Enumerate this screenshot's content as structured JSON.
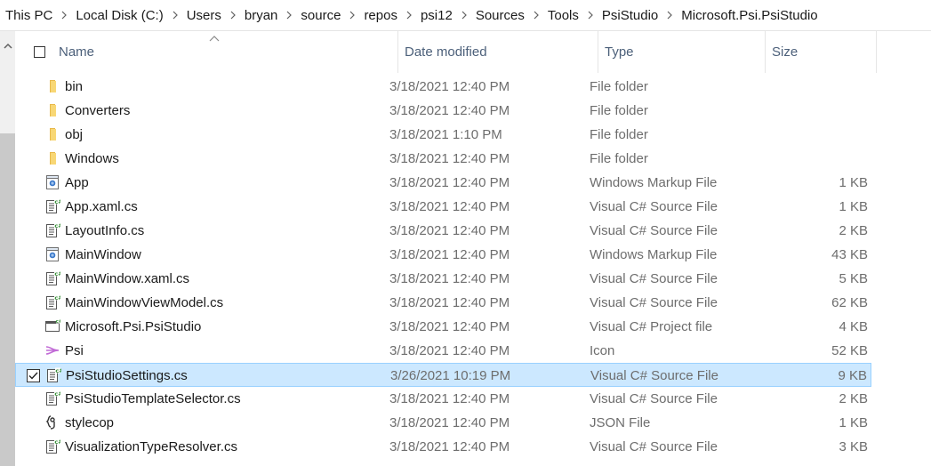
{
  "breadcrumb": [
    "This PC",
    "Local Disk (C:)",
    "Users",
    "bryan",
    "source",
    "repos",
    "psi12",
    "Sources",
    "Tools",
    "PsiStudio",
    "Microsoft.Psi.PsiStudio"
  ],
  "columns": {
    "name": "Name",
    "date": "Date modified",
    "type": "Type",
    "size": "Size"
  },
  "files": [
    {
      "name": "bin",
      "date": "3/18/2021 12:40 PM",
      "type": "File folder",
      "size": "",
      "icon": "folder-icon"
    },
    {
      "name": "Converters",
      "date": "3/18/2021 12:40 PM",
      "type": "File folder",
      "size": "",
      "icon": "folder-icon"
    },
    {
      "name": "obj",
      "date": "3/18/2021 1:10 PM",
      "type": "File folder",
      "size": "",
      "icon": "folder-icon"
    },
    {
      "name": "Windows",
      "date": "3/18/2021 12:40 PM",
      "type": "File folder",
      "size": "",
      "icon": "folder-icon"
    },
    {
      "name": "App",
      "date": "3/18/2021 12:40 PM",
      "type": "Windows Markup File",
      "size": "1 KB",
      "icon": "xaml-file-icon"
    },
    {
      "name": "App.xaml.cs",
      "date": "3/18/2021 12:40 PM",
      "type": "Visual C# Source File",
      "size": "1 KB",
      "icon": "csharp-file-icon"
    },
    {
      "name": "LayoutInfo.cs",
      "date": "3/18/2021 12:40 PM",
      "type": "Visual C# Source File",
      "size": "2 KB",
      "icon": "csharp-file-icon"
    },
    {
      "name": "MainWindow",
      "date": "3/18/2021 12:40 PM",
      "type": "Windows Markup File",
      "size": "43 KB",
      "icon": "xaml-file-icon"
    },
    {
      "name": "MainWindow.xaml.cs",
      "date": "3/18/2021 12:40 PM",
      "type": "Visual C# Source File",
      "size": "5 KB",
      "icon": "csharp-file-icon"
    },
    {
      "name": "MainWindowViewModel.cs",
      "date": "3/18/2021 12:40 PM",
      "type": "Visual C# Source File",
      "size": "62 KB",
      "icon": "csharp-file-icon"
    },
    {
      "name": "Microsoft.Psi.PsiStudio",
      "date": "3/18/2021 12:40 PM",
      "type": "Visual C# Project file",
      "size": "4 KB",
      "icon": "csproj-file-icon"
    },
    {
      "name": "Psi",
      "date": "3/18/2021 12:40 PM",
      "type": "Icon",
      "size": "52 KB",
      "icon": "psi-icon-file-icon"
    },
    {
      "name": "PsiStudioSettings.cs",
      "date": "3/26/2021 10:19 PM",
      "type": "Visual C# Source File",
      "size": "9 KB",
      "icon": "csharp-file-icon",
      "selected": true
    },
    {
      "name": "PsiStudioTemplateSelector.cs",
      "date": "3/18/2021 12:40 PM",
      "type": "Visual C# Source File",
      "size": "2 KB",
      "icon": "csharp-file-icon"
    },
    {
      "name": "stylecop",
      "date": "3/18/2021 12:40 PM",
      "type": "JSON File",
      "size": "1 KB",
      "icon": "json-file-icon"
    },
    {
      "name": "VisualizationTypeResolver.cs",
      "date": "3/18/2021 12:40 PM",
      "type": "Visual C# Source File",
      "size": "3 KB",
      "icon": "csharp-file-icon"
    }
  ],
  "colors": {
    "selected_bg": "#cce8ff",
    "selected_border": "#99d1ff",
    "folder": "#f8d775",
    "psi_icon": "#c16ad6"
  }
}
